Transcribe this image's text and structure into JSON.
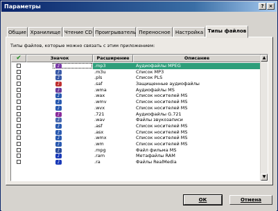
{
  "window": {
    "title": "Параметры",
    "help_label": "?",
    "close_label": "×"
  },
  "tabs": [
    {
      "label": "Общие"
    },
    {
      "label": "Хранилище"
    },
    {
      "label": "Чтение CD"
    },
    {
      "label": "Проигрыватель"
    },
    {
      "label": "Переносное"
    },
    {
      "label": "Настройка"
    },
    {
      "label": "Типы файлов",
      "active": true
    }
  ],
  "panel": {
    "description": "Типы файлов, которые можно связать с этим приложением:"
  },
  "table": {
    "columns": {
      "check": "✔",
      "icon": "Значок",
      "extension": "Расширение",
      "description": "Описание"
    },
    "rows": [
      {
        "ext": ".mp3",
        "desc": "Аудиофайлы MPEG",
        "icon": "audio-mp3-icon",
        "color": "#7a3aa8",
        "selected": true
      },
      {
        "ext": ".m3u",
        "desc": "Список MP3",
        "icon": "playlist-icon",
        "color": "#3a5aa8"
      },
      {
        "ext": ".pls",
        "desc": "Список PLS",
        "icon": "playlist-icon",
        "color": "#3a5aa8"
      },
      {
        "ext": ".saf",
        "desc": "Защищенные аудиофайлы",
        "icon": "protected-audio-icon",
        "color": "#c03030"
      },
      {
        "ext": ".wma",
        "desc": "Аудиофайлы MS",
        "icon": "audio-wma-icon",
        "color": "#6a3a9a"
      },
      {
        "ext": ".wax",
        "desc": "Список носителей MS",
        "icon": "media-list-icon",
        "color": "#2a5ab0"
      },
      {
        "ext": ".wmv",
        "desc": "Список носителей MS",
        "icon": "media-list-icon",
        "color": "#2a5ab0"
      },
      {
        "ext": ".wvx",
        "desc": "Список носителей MS",
        "icon": "media-list-icon",
        "color": "#2a5ab0"
      },
      {
        "ext": ".721",
        "desc": "Аудиофайлы G.721",
        "icon": "audio-g721-icon",
        "color": "#8a2a9a"
      },
      {
        "ext": ".wav",
        "desc": "Файлы звукозаписи",
        "icon": "wave-audio-icon",
        "color": "#4a6ab0"
      },
      {
        "ext": ".asf",
        "desc": "Список носителей MS",
        "icon": "media-list-icon",
        "color": "#2a5ab0"
      },
      {
        "ext": ".asx",
        "desc": "Список носителей MS",
        "icon": "media-list-icon",
        "color": "#2a5ab0"
      },
      {
        "ext": ".wmx",
        "desc": "Список носителей MS",
        "icon": "media-list-icon",
        "color": "#2a5ab0"
      },
      {
        "ext": ".wm",
        "desc": "Список носителей MS",
        "icon": "media-list-icon",
        "color": "#2a5ab0"
      },
      {
        "ext": ".mpg",
        "desc": "Файл фильма MS",
        "icon": "movie-file-icon",
        "color": "#2a4a9a"
      },
      {
        "ext": ".ram",
        "desc": "Метафайлы RAM",
        "icon": "realmedia-icon",
        "color": "#1a3ab8"
      },
      {
        "ext": ".ra",
        "desc": "Файлы RealMedia",
        "icon": "realmedia-icon",
        "color": "#1a3ab8"
      }
    ]
  },
  "buttons": {
    "ok": "ОК",
    "cancel": "Отмена"
  },
  "scrollbar": {
    "up": "▲",
    "down": "▼"
  }
}
